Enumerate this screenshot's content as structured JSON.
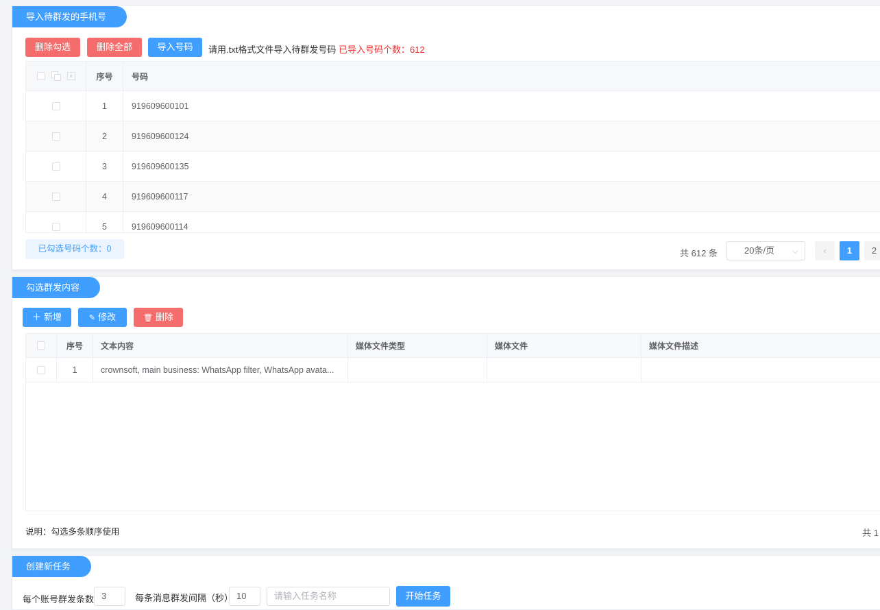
{
  "import_panel": {
    "title": "导入待群发的手机号",
    "btn_delete_checked": "删除勾选",
    "btn_delete_all": "删除全部",
    "btn_import": "导入号码",
    "hint": "请用.txt格式文件导入待群发号码",
    "imported_count_text": "已导入号码个数：612",
    "table": {
      "headers": [
        "序号",
        "号码"
      ],
      "rows": [
        {
          "index": "1",
          "number": "919609600101"
        },
        {
          "index": "2",
          "number": "919609600124"
        },
        {
          "index": "3",
          "number": "919609600135"
        },
        {
          "index": "4",
          "number": "919609600117"
        },
        {
          "index": "5",
          "number": "919609600114"
        }
      ]
    },
    "selected_count_text": "已勾选号码个数：0",
    "pager": {
      "total_text": "共 612 条",
      "page_size": "20条/页",
      "prev": "‹",
      "pages": [
        "1",
        "2"
      ],
      "current": "1"
    }
  },
  "content_panel": {
    "title": "勾选群发内容",
    "btn_add": "新增",
    "btn_edit": "修改",
    "btn_delete": "删除",
    "table": {
      "headers": [
        "序号",
        "文本内容",
        "媒体文件类型",
        "媒体文件",
        "媒体文件描述"
      ],
      "rows": [
        {
          "index": "1",
          "text": "crownsoft, main business: WhatsApp filter, WhatsApp avata...",
          "media_type": "",
          "media_file": "",
          "media_desc": ""
        }
      ]
    },
    "note": "说明：勾选多条顺序使用",
    "total_text": "共 1"
  },
  "task_panel": {
    "title": "创建新任务",
    "per_account_label": "每个账号群发条数",
    "per_account_value": "3",
    "interval_label": "每条消息群发间隔（秒）",
    "interval_value": "10",
    "task_name_placeholder": "请输入任务名称",
    "btn_start": "开始任务"
  },
  "colors": {
    "primary": "#409eff",
    "danger": "#f56c6c",
    "count_red": "#f02b2b"
  },
  "icons": [
    "checkbox-icon",
    "copy-icon",
    "clear-icon",
    "plus-icon",
    "edit-icon",
    "trash-icon",
    "chevron-down-icon"
  ]
}
